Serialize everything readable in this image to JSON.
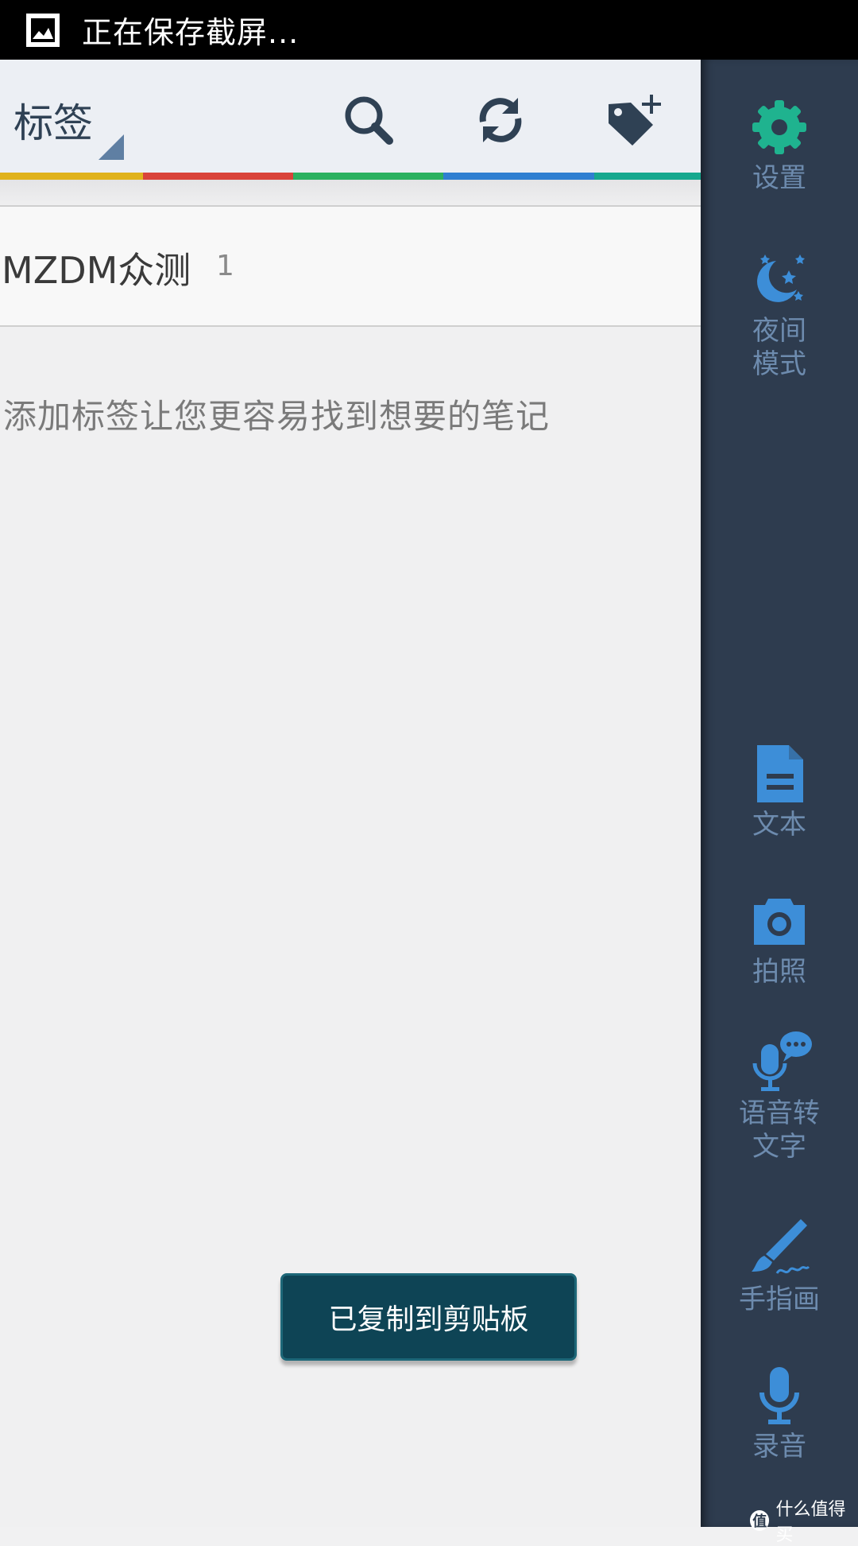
{
  "status_bar": {
    "text": "正在保存截屏..."
  },
  "toolbar": {
    "title": "标签",
    "search_icon": "search-icon",
    "sync_icon": "sync-icon",
    "add_tag_icon": "add-tag-icon"
  },
  "color_strip": [
    "#e0b21c",
    "#d9433a",
    "#2bb160",
    "#2f7fd1",
    "#16a88e"
  ],
  "tag_list": [
    {
      "name": "MZDM众测",
      "count": "1"
    }
  ],
  "hint": "添加标签让您更容易找到想要的笔记",
  "toast": "已复制到剪贴板",
  "sidebar": {
    "items": [
      {
        "label": "设置",
        "icon": "gear-icon",
        "color": "#1fb38f"
      },
      {
        "label": "夜间\n模式",
        "icon": "night-mode-icon",
        "color": "#3d8ed8"
      },
      {
        "label": "文本",
        "icon": "document-icon",
        "color": "#3d8ed8"
      },
      {
        "label": "拍照",
        "icon": "camera-icon",
        "color": "#3d8ed8"
      },
      {
        "label": "语音转\n文字",
        "icon": "speech-to-text-icon",
        "color": "#3d8ed8"
      },
      {
        "label": "手指画",
        "icon": "brush-icon",
        "color": "#3d8ed8"
      },
      {
        "label": "录音",
        "icon": "microphone-icon",
        "color": "#3d8ed8"
      }
    ]
  },
  "watermark": "什么值得买",
  "watermark_badge": "值"
}
